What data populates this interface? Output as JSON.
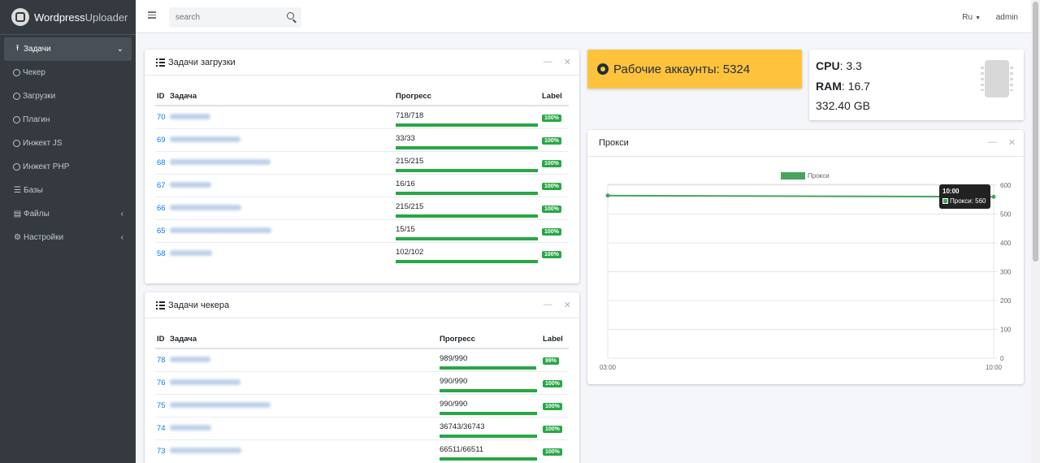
{
  "brand": {
    "bold": "Wordpress",
    "light": "Uploader"
  },
  "sidebar": {
    "items": [
      {
        "label": "Задачи",
        "arrow": "⌄"
      },
      {
        "label": "Чекер"
      },
      {
        "label": "Загрузки"
      },
      {
        "label": "Плагин"
      },
      {
        "label": "Инжект JS"
      },
      {
        "label": "Инжект PHP"
      },
      {
        "label": "Базы"
      },
      {
        "label": "Файлы",
        "arrow": "‹"
      },
      {
        "label": "Настройки",
        "arrow": "‹"
      }
    ]
  },
  "topbar": {
    "search_placeholder": "search",
    "lang": "Ru",
    "user": "admin"
  },
  "upload_tasks": {
    "title": "Задачи загрузки",
    "headers": [
      "ID",
      "Задача",
      "Прогресс",
      "Label"
    ],
    "rows": [
      {
        "id": "70",
        "progress": "718/718",
        "percent": 1.0,
        "label": "100%"
      },
      {
        "id": "69",
        "progress": "33/33",
        "percent": 1.0,
        "label": "100%"
      },
      {
        "id": "68",
        "progress": "215/215",
        "percent": 1.0,
        "label": "100%"
      },
      {
        "id": "67",
        "progress": "16/16",
        "percent": 1.0,
        "label": "100%"
      },
      {
        "id": "66",
        "progress": "215/215",
        "percent": 1.0,
        "label": "100%"
      },
      {
        "id": "65",
        "progress": "15/15",
        "percent": 1.0,
        "label": "100%"
      },
      {
        "id": "58",
        "progress": "102/102",
        "percent": 1.0,
        "label": "100%"
      }
    ]
  },
  "checker_tasks": {
    "title": "Задачи чекера",
    "headers": [
      "ID",
      "Задача",
      "Прогресс",
      "Label"
    ],
    "rows": [
      {
        "id": "78",
        "progress": "989/990",
        "percent": 0.99,
        "label": "99%"
      },
      {
        "id": "76",
        "progress": "990/990",
        "percent": 1.0,
        "label": "100%"
      },
      {
        "id": "75",
        "progress": "990/990",
        "percent": 1.0,
        "label": "100%"
      },
      {
        "id": "74",
        "progress": "36743/36743",
        "percent": 1.0,
        "label": "100%"
      },
      {
        "id": "73",
        "progress": "66511/66511",
        "percent": 1.0,
        "label": "100%"
      }
    ]
  },
  "accounts": {
    "label": "Рабочие аккаунты:",
    "value": "5324"
  },
  "system": {
    "cpu_label": "CPU",
    "cpu_value": ": 3.3",
    "ram_label": "RAM",
    "ram_value": ": 16.7",
    "disk": "332.40 GB"
  },
  "proxy_card": {
    "title": "Прокси"
  },
  "tooltip": {
    "time": "10:00",
    "text": "Прокси: 560"
  },
  "chart_data": {
    "type": "line",
    "series": [
      {
        "name": "Прокси",
        "x": [
          "03:00",
          "10:00"
        ],
        "values": [
          564,
          560
        ],
        "color": "#47a35f"
      }
    ],
    "x_ticks": [
      "03:00",
      "10:00"
    ],
    "y_ticks": [
      0,
      100,
      200,
      300,
      400,
      500,
      600
    ],
    "ylim": [
      0,
      600
    ],
    "y_axis_position": "right",
    "legend": "top",
    "grid": true
  }
}
